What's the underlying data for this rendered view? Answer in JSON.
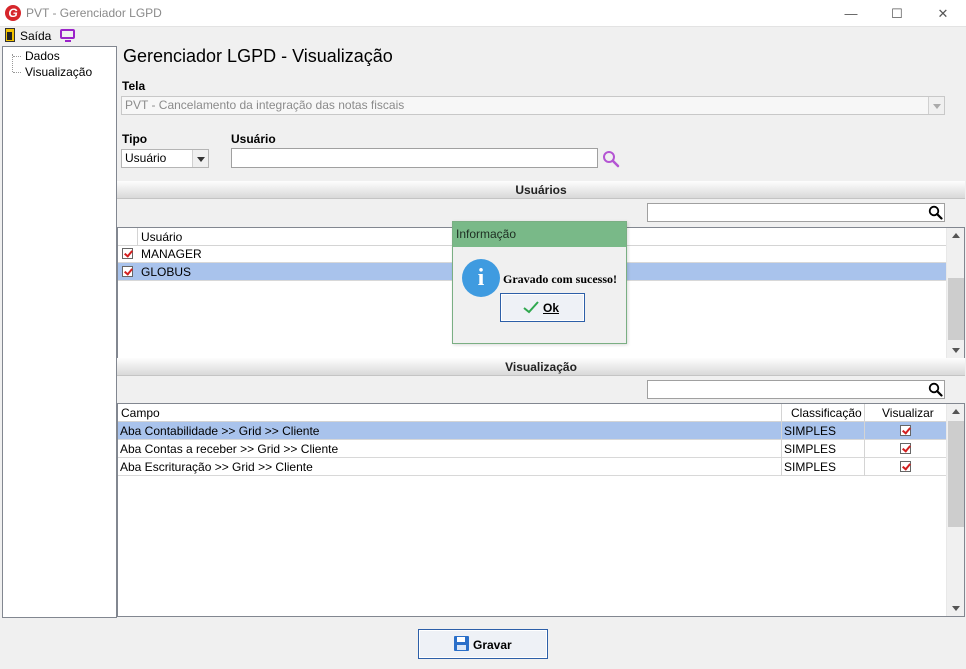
{
  "window": {
    "logo_letter": "G",
    "title": "PVT - Gerenciador LGPD",
    "minimize": "—",
    "maximize": "☐",
    "close": "✕"
  },
  "toolbar": {
    "exit_label": "Saída"
  },
  "tree": {
    "items": [
      "Dados",
      "Visualização"
    ]
  },
  "main": {
    "title": "Gerenciador LGPD - Visualização",
    "tela_label": "Tela",
    "tela_value": "PVT - Cancelamento da integração das notas fiscais",
    "tipo_label": "Tipo",
    "tipo_value": "Usuário",
    "usuario_label": "Usuário",
    "usuario_value": ""
  },
  "users_section": {
    "title": "Usuários",
    "column": "Usuário",
    "rows": [
      {
        "name": "MANAGER",
        "checked": true,
        "selected": false
      },
      {
        "name": "GLOBUS",
        "checked": true,
        "selected": true
      }
    ]
  },
  "view_section": {
    "title": "Visualização",
    "columns": [
      "Campo",
      "Classificação",
      "Visualizar"
    ],
    "rows": [
      {
        "campo": "Aba Contabilidade >> Grid >> Cliente",
        "classificacao": "SIMPLES",
        "visualizar": true,
        "selected": true
      },
      {
        "campo": "Aba Contas a receber >> Grid >> Cliente",
        "classificacao": "SIMPLES",
        "visualizar": true,
        "selected": false
      },
      {
        "campo": "Aba Escrituração >> Grid >> Cliente",
        "classificacao": "SIMPLES",
        "visualizar": true,
        "selected": false
      }
    ]
  },
  "dialog": {
    "title": "Informação",
    "icon_letter": "i",
    "message": "Gravado com sucesso!",
    "ok_label": "Ok"
  },
  "footer": {
    "save_label": "Gravar"
  },
  "colors": {
    "selection": "#a9c3ec",
    "dialog_header": "#79b988",
    "info_icon": "#3f9be0",
    "check": "#d21f1f",
    "search_icon": "#b455d3"
  }
}
